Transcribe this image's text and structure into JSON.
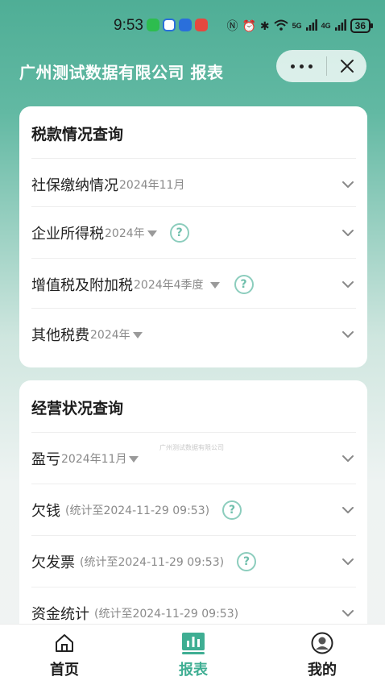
{
  "status_bar": {
    "time": "9:53",
    "network_5g_a": "5G",
    "network_5g_b": "4G",
    "battery": "36"
  },
  "header": {
    "title": "广州测试数据有限公司 报表"
  },
  "tax_section": {
    "title": "税款情况查询",
    "rows": [
      {
        "label": "社保缴纳情况",
        "sub": "2024年11月"
      },
      {
        "label": "企业所得税",
        "sub": "2024年"
      },
      {
        "label": "增值税及附加税",
        "sub": "2024年4季度"
      },
      {
        "label": "其他税费",
        "sub": "2024年"
      }
    ]
  },
  "business_section": {
    "title": "经营状况查询",
    "watermark": "广州测试数据有限公司",
    "rows": [
      {
        "label": "盈亏",
        "sub": "2024年11月"
      },
      {
        "label": "欠钱",
        "sub": "(统计至2024-11-29 09:53)"
      },
      {
        "label": "欠发票",
        "sub": "(统计至2024-11-29 09:53)"
      },
      {
        "label": "资金统计",
        "sub": "(统计至2024-11-29 09:53)"
      }
    ]
  },
  "tabbar": {
    "home": "首页",
    "report": "报表",
    "mine": "我的"
  },
  "colors": {
    "accent": "#3fae93",
    "header_bg": "#4fae96",
    "help_icon": "#8ccdbd"
  }
}
